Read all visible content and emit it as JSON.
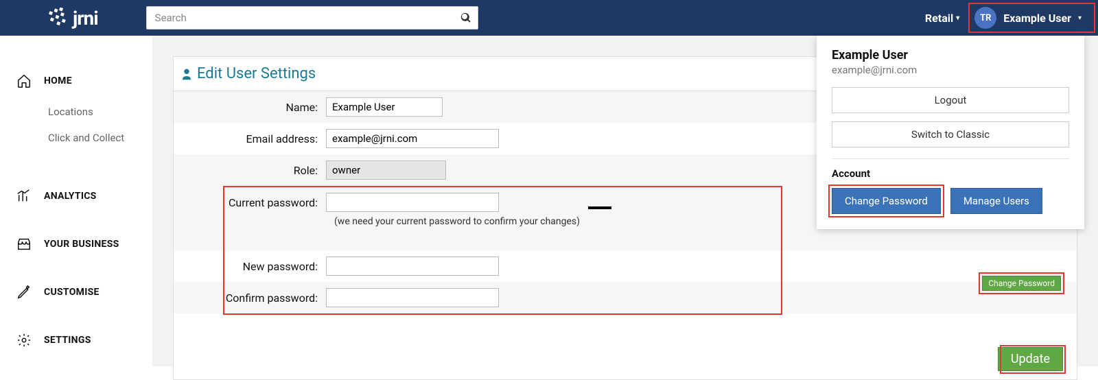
{
  "topbar": {
    "brand": "jrni",
    "search_placeholder": "Search",
    "retail_label": "Retail",
    "user_initials": "TR",
    "user_name": "Example User"
  },
  "sidebar": {
    "home": "HOME",
    "home_sub": [
      "Locations",
      "Click and Collect"
    ],
    "analytics": "ANALYTICS",
    "business": "YOUR BUSINESS",
    "customise": "CUSTOMISE",
    "settings": "SETTINGS"
  },
  "panel": {
    "title": "Edit User Settings",
    "labels": {
      "name": "Name:",
      "email": "Email address:",
      "role": "Role:",
      "current_pw": "Current password:",
      "current_pw_hint": "(we need your current password to confirm your changes)",
      "new_pw": "New password:",
      "confirm_pw": "Confirm password:"
    },
    "values": {
      "name": "Example User",
      "email": "example@jrni.com",
      "role": "owner",
      "current_pw": "",
      "new_pw": "",
      "confirm_pw": ""
    },
    "change_pw_btn": "Change Password",
    "update_btn": "Update"
  },
  "popover": {
    "name": "Example User",
    "email": "example@jrni.com",
    "logout": "Logout",
    "switch": "Switch to Classic",
    "account_heading": "Account",
    "change_password": "Change Password",
    "manage_users": "Manage Users"
  }
}
